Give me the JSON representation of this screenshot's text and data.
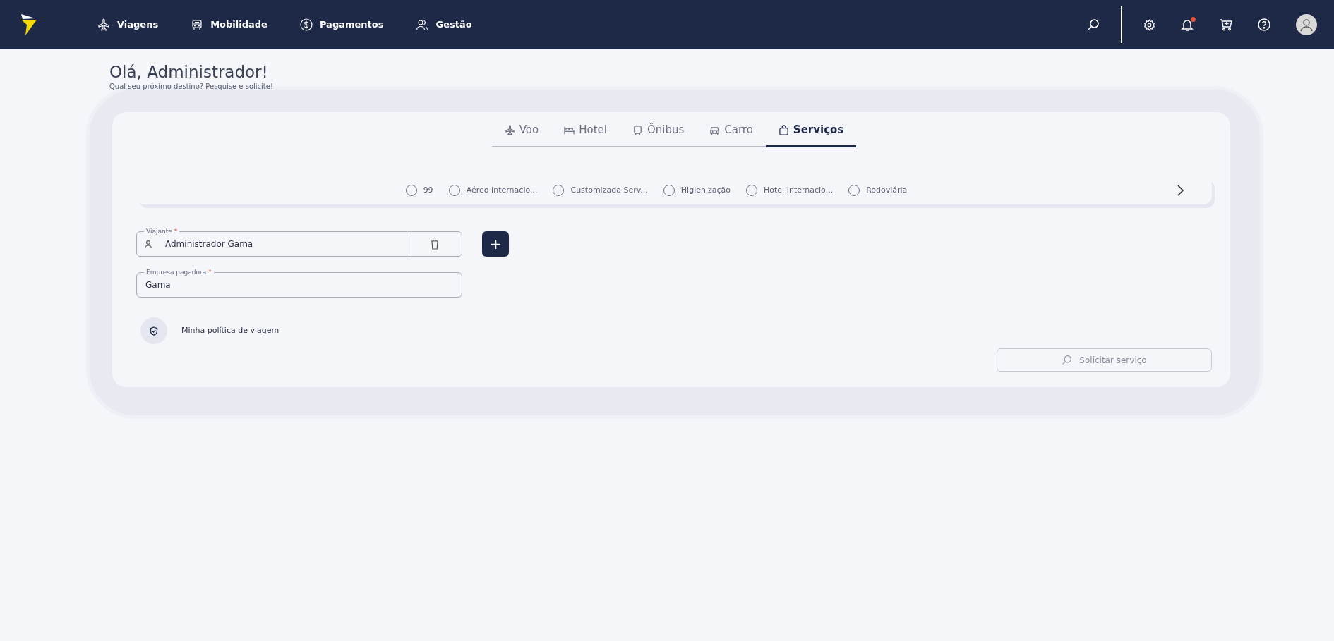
{
  "navbar": {
    "menu": [
      {
        "label": "Viagens"
      },
      {
        "label": "Mobilidade"
      },
      {
        "label": "Pagamentos"
      },
      {
        "label": "Gestão"
      }
    ],
    "notification_unread": true
  },
  "greeting": {
    "title": "Olá, Administrador!",
    "subtitle": "Qual seu próximo destino? Pesquise e solicite!"
  },
  "tabs": [
    {
      "label": "Voo",
      "selected": false
    },
    {
      "label": "Hotel",
      "selected": false
    },
    {
      "label": "Ônibus",
      "selected": false
    },
    {
      "label": "Carro",
      "selected": false
    },
    {
      "label": "Serviços",
      "selected": true
    }
  ],
  "service_options": [
    {
      "label": "99",
      "selected": false
    },
    {
      "label": "Aéreo Internacio...",
      "selected": false
    },
    {
      "label": "Customizada Serv...",
      "selected": false
    },
    {
      "label": "Higienização",
      "selected": false
    },
    {
      "label": "Hotel Internacio...",
      "selected": false
    },
    {
      "label": "Rodoviária",
      "selected": false
    }
  ],
  "traveler_field": {
    "label": "Viajante",
    "required_mark": "*",
    "value": "Administrador Gama"
  },
  "company_field": {
    "label": "Empresa pagadora",
    "required_mark": "*",
    "value": "Gama"
  },
  "policy_link": "Minha política de viagem",
  "submit_button": {
    "label": "Solicitar serviço",
    "disabled": true
  }
}
